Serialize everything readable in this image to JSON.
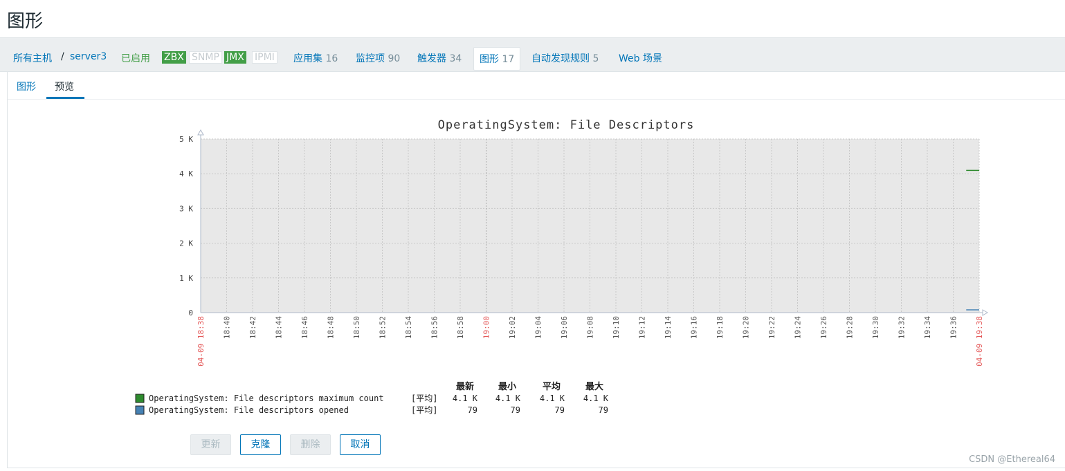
{
  "page": {
    "title": "图形"
  },
  "breadcrumb": {
    "all_hosts": "所有主机",
    "separator": "/",
    "host": "server3"
  },
  "host_status": "已启用",
  "interfaces": [
    {
      "label": "ZBX",
      "active": true
    },
    {
      "label": "SNMP",
      "active": false
    },
    {
      "label": "JMX",
      "active": true
    },
    {
      "label": "IPMI",
      "active": false
    }
  ],
  "nav": {
    "applications": {
      "label": "应用集",
      "count": "16"
    },
    "items": {
      "label": "监控项",
      "count": "90"
    },
    "triggers": {
      "label": "触发器",
      "count": "34"
    },
    "graphs": {
      "label": "图形",
      "count": "17"
    },
    "discovery": {
      "label": "自动发现规则",
      "count": "5"
    },
    "web": {
      "label": "Web 场景"
    }
  },
  "subtabs": {
    "graph": "图形",
    "preview": "预览"
  },
  "chart_data": {
    "type": "line",
    "title": "OperatingSystem: File Descriptors",
    "y_ticks": [
      "0",
      "1 K",
      "2 K",
      "3 K",
      "4 K",
      "5 K"
    ],
    "ylim": [
      0,
      5000
    ],
    "x_tick_labels": [
      "18:40",
      "18:42",
      "18:44",
      "18:46",
      "18:48",
      "18:50",
      "18:52",
      "18:54",
      "18:56",
      "18:58",
      "19:00",
      "19:02",
      "19:04",
      "19:06",
      "19:08",
      "19:10",
      "19:12",
      "19:14",
      "19:16",
      "19:18",
      "19:20",
      "19:22",
      "19:24",
      "19:26",
      "19:28",
      "19:30",
      "19:32",
      "19:34",
      "19:36"
    ],
    "x_start_label": "04-09 18:38",
    "x_end_label": "04-09 19:38",
    "highlight_tick": "19:00",
    "x_range_minutes": [
      "18:38",
      "19:38"
    ],
    "grid": true,
    "series": [
      {
        "name": "OperatingSystem: File descriptors maximum count",
        "color": "#2e8b2e",
        "x": [
          "19:37",
          "19:38"
        ],
        "values": [
          4096,
          4096
        ]
      },
      {
        "name": "OperatingSystem: File descriptors opened",
        "color": "#4682b4",
        "x": [
          "19:37",
          "19:38"
        ],
        "values": [
          79,
          79
        ]
      }
    ],
    "legend": {
      "headers": [
        "最新",
        "最小",
        "平均",
        "最大"
      ],
      "func": "[平均]",
      "rows": [
        {
          "last": "4.1 K",
          "min": "4.1 K",
          "avg": "4.1 K",
          "max": "4.1 K"
        },
        {
          "last": "79",
          "min": "79",
          "avg": "79",
          "max": "79"
        }
      ]
    }
  },
  "buttons": {
    "update": "更新",
    "clone": "克隆",
    "delete": "删除",
    "cancel": "取消"
  },
  "watermark": "CSDN @Ethereal64"
}
